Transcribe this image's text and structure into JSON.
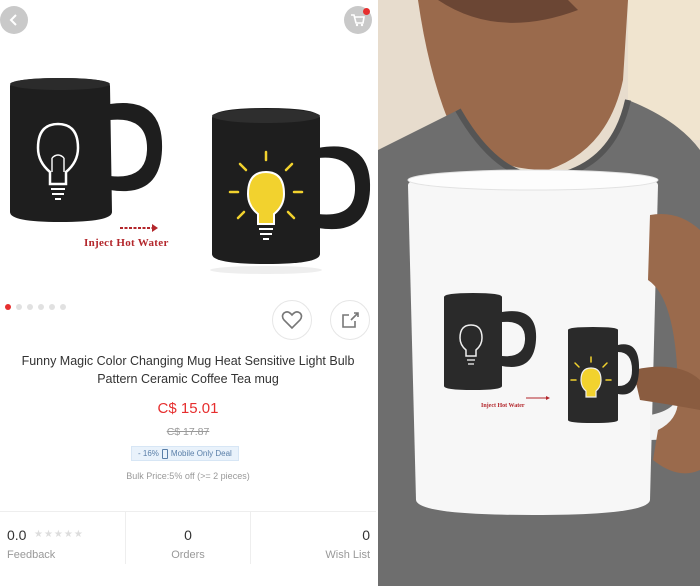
{
  "product": {
    "image_caption": "Inject  Hot Water",
    "title": "Funny Magic Color Changing Mug Heat Sensitive Light Bulb Pattern Ceramic Coffee Tea mug",
    "price": "C$ 15.01",
    "original_price": "C$ 17.87",
    "discount": "- 16%",
    "deal_label": "Mobile Only Deal",
    "bulk_price": "Bulk Price:5% off (>= 2 pieces)",
    "gallery_total": 6,
    "gallery_active": 1
  },
  "stats": {
    "feedback_value": "0.0",
    "feedback_label": "Feedback",
    "orders_value": "0",
    "orders_label": "Orders",
    "wishlist_value": "0",
    "wishlist_label": "Wish List",
    "stars": "★★★★★"
  },
  "photo": {
    "mug_print_text": "Inject  Hot Water"
  },
  "icons": {
    "back": "chevron-left-icon",
    "cart": "cart-icon",
    "wish": "heart-icon",
    "share": "share-icon"
  },
  "colors": {
    "accent": "#e62e2e",
    "caption_red": "#b3262b",
    "mug_black": "#1e1e1e",
    "bulb_yellow": "#f2d22e",
    "shirt_grey": "#6e6e6e"
  }
}
